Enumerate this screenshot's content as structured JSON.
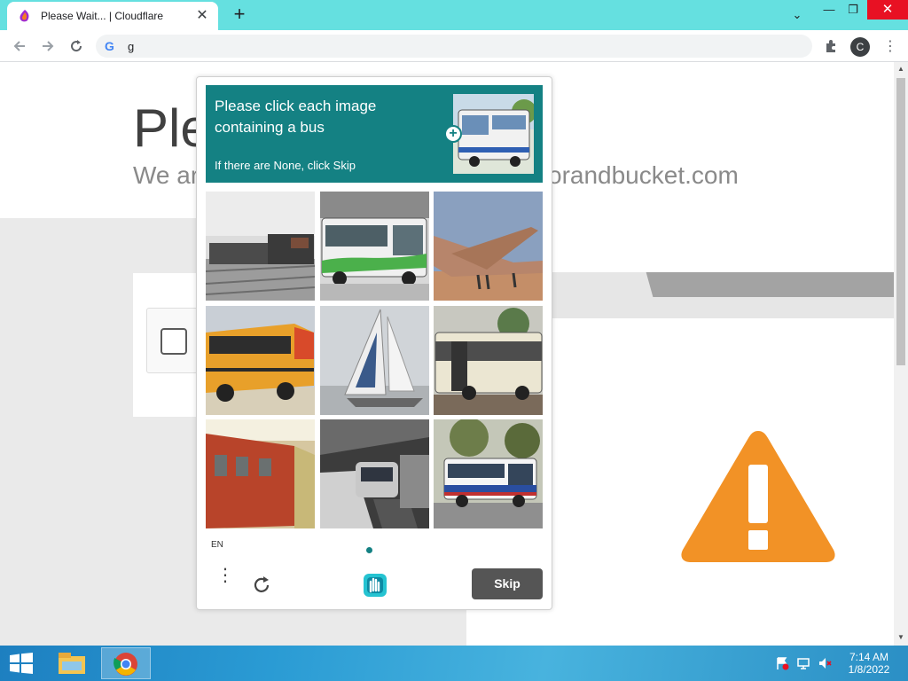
{
  "browser": {
    "tab_title": "Please Wait... | Cloudflare",
    "tab_close": "✕",
    "new_tab": "+",
    "tab_search": "⌄",
    "minimize": "—",
    "maximize": "❐",
    "close": "✕",
    "address": "g",
    "google_icon": "G",
    "profile_initial": "C",
    "menu": "⋮"
  },
  "page": {
    "heading": "Ple",
    "subheading": "We ar",
    "subheading_right": "orandbucket.com"
  },
  "captcha": {
    "prompt_text": "Please click each image containing a bus",
    "prompt_skip_hint": "If there are None, click Skip",
    "prompt_plus": "+",
    "language": "EN",
    "menu": "⋮",
    "skip_button": "Skip",
    "tiles": [
      "train",
      "bus",
      "airplane",
      "bus",
      "sailboat",
      "bus",
      "train",
      "train",
      "bus"
    ]
  },
  "taskbar": {
    "time": "7:14 AM",
    "date": "1/8/2022"
  },
  "icons": {
    "favicon": "cloudflare-favicon-icon",
    "warning": "warning-triangle-icon",
    "captcha_logo": "hcaptcha-hand-icon"
  },
  "colors": {
    "tabbar": "#65e0e0",
    "captcha_teal": "#148183",
    "warning_orange": "#f29226",
    "skip_button": "#555555",
    "close_red": "#e81123"
  }
}
